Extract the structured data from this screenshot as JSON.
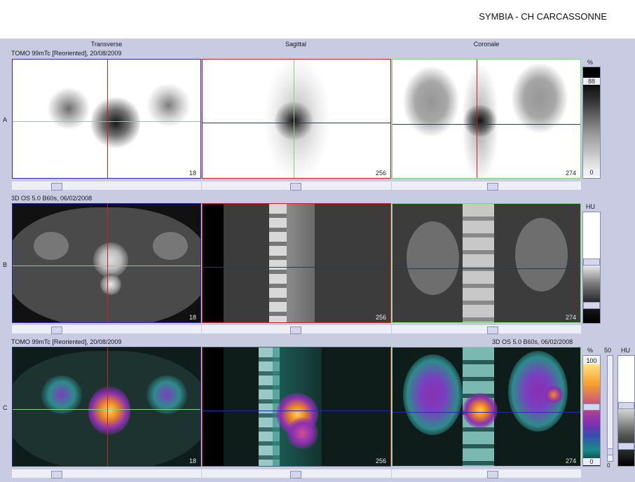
{
  "header": {
    "title": "SYMBIA - CH CARCASSONNE"
  },
  "columns": [
    "Transverse",
    "Sagittal",
    "Coronale"
  ],
  "rows": [
    {
      "label": "A",
      "series": "TOMO 99mTc [Reoriented], 20/08/2009",
      "slices": [
        "18",
        "256",
        "274"
      ]
    },
    {
      "label": "B",
      "series": "3D  OS  5.0  B60s, 06/02/2008",
      "slices": [
        "18",
        "256",
        "274"
      ]
    },
    {
      "label": "C",
      "series": "TOMO 99mTc [Reoriented], 20/08/2009",
      "series_right": "3D  OS  5.0  B60s, 06/02/2008",
      "slices": [
        "18",
        "256",
        "274"
      ]
    }
  ],
  "scales": {
    "spect": {
      "unit": "%",
      "top": "88",
      "bottom": "0"
    },
    "ct": {
      "unit": "HU"
    },
    "fusion": {
      "unit": "%",
      "top": "100",
      "bottom": "0",
      "mid_label": "50",
      "unit2": "HU",
      "small_zero": "0"
    }
  },
  "colors": {
    "background": "#c9cbe3",
    "crosshair_red": "#d02020",
    "crosshair_green": "#7ed87e",
    "crosshair_blue": "#2a2aa8"
  }
}
